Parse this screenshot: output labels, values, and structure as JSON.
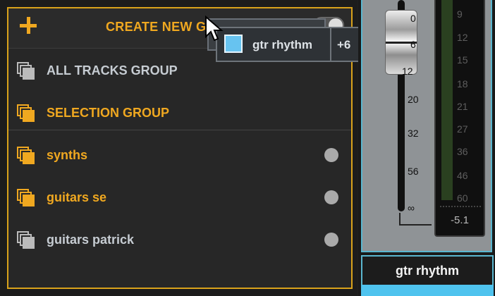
{
  "group_list": {
    "create_label": "CREATE NEW G",
    "rows": [
      {
        "label": "ALL TRACKS GROUP",
        "icon": "all-tracks-group-icon",
        "style": "grey",
        "dot": false
      },
      {
        "label": "SELECTION GROUP",
        "icon": "selection-group-icon",
        "style": "gold",
        "dot": false
      },
      {
        "label": "synths",
        "icon": "group-icon",
        "style": "gold",
        "dot": true
      },
      {
        "label": "guitars se",
        "icon": "group-icon",
        "style": "gold",
        "dot": true
      },
      {
        "label": "guitars patrick",
        "icon": "group-icon",
        "style": "grey",
        "dot": true
      }
    ]
  },
  "drag_tooltip": {
    "track_name": "gtr rhythm",
    "count": "+6",
    "swatch_color": "#67c3f0"
  },
  "channel_strip": {
    "fader_scale": [
      "0",
      "6",
      "12",
      "20",
      "32",
      "56",
      "∞"
    ],
    "meter_scale": [
      "9",
      "12",
      "15",
      "18",
      "21",
      "27",
      "36",
      "46",
      "60"
    ],
    "meter_value": "-5.1",
    "track_name": "gtr rhythm",
    "track_color": "#4fc3ee"
  },
  "colors": {
    "accent": "#f0a820",
    "highlight": "#5ab6cf"
  }
}
